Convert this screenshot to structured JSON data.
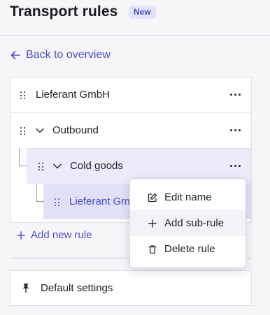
{
  "header": {
    "title": "Transport rules",
    "badge": "New"
  },
  "nav": {
    "back_label": "Back to overview"
  },
  "rules": [
    {
      "label": "Lieferant GmbH",
      "depth": 0
    },
    {
      "label": "Outbound",
      "depth": 0,
      "expanded": true
    },
    {
      "label": "Cold goods",
      "depth": 1,
      "expanded": true
    },
    {
      "label": "Lieferant Gm",
      "depth": 2,
      "selected": true
    }
  ],
  "add_rule_label": "Add new rule",
  "default_settings_label": "Default settings",
  "context_menu": {
    "items": [
      {
        "label": "Edit name",
        "icon": "edit-icon"
      },
      {
        "label": "Add sub-rule",
        "icon": "plus-icon"
      },
      {
        "label": "Delete rule",
        "icon": "trash-icon"
      }
    ]
  },
  "colors": {
    "accent": "#4a4ec7",
    "selected_row": "#e0e1f7",
    "badge_bg": "#e2e3fb"
  }
}
